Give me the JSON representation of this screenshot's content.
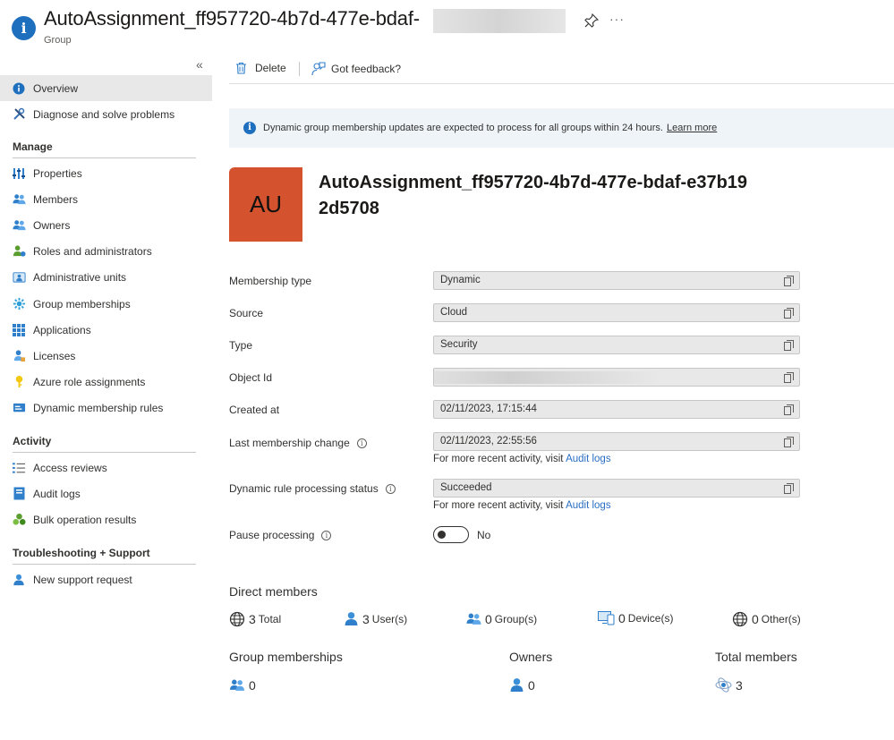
{
  "header": {
    "title": "AutoAssignment_ff957720-4b7d-477e-bdaf-",
    "subtitle": "Group"
  },
  "sidebar": {
    "top_items": [
      {
        "label": "Overview",
        "icon": "info-icon"
      },
      {
        "label": "Diagnose and solve problems",
        "icon": "wrench-icon"
      }
    ],
    "sections": [
      {
        "title": "Manage",
        "items": [
          {
            "label": "Properties",
            "icon": "properties-icon"
          },
          {
            "label": "Members",
            "icon": "members-icon"
          },
          {
            "label": "Owners",
            "icon": "owners-icon"
          },
          {
            "label": "Roles and administrators",
            "icon": "roles-icon"
          },
          {
            "label": "Administrative units",
            "icon": "admin-units-icon"
          },
          {
            "label": "Group memberships",
            "icon": "group-memberships-icon"
          },
          {
            "label": "Applications",
            "icon": "applications-icon"
          },
          {
            "label": "Licenses",
            "icon": "licenses-icon"
          },
          {
            "label": "Azure role assignments",
            "icon": "key-icon"
          },
          {
            "label": "Dynamic membership rules",
            "icon": "dynamic-rules-icon"
          }
        ]
      },
      {
        "title": "Activity",
        "items": [
          {
            "label": "Access reviews",
            "icon": "access-reviews-icon"
          },
          {
            "label": "Audit logs",
            "icon": "audit-logs-icon"
          },
          {
            "label": "Bulk operation results",
            "icon": "bulk-icon"
          }
        ]
      },
      {
        "title": "Troubleshooting + Support",
        "items": [
          {
            "label": "New support request",
            "icon": "support-icon"
          }
        ]
      }
    ]
  },
  "toolbar": {
    "delete_label": "Delete",
    "feedback_label": "Got feedback?"
  },
  "banner": {
    "text": "Dynamic group membership updates are expected to process for all groups within 24 hours.",
    "link": "Learn more"
  },
  "group": {
    "initials": "AU",
    "name": "AutoAssignment_ff957720-4b7d-477e-bdaf-e37b192d5708"
  },
  "properties": {
    "membership_type": {
      "label": "Membership type",
      "value": "Dynamic"
    },
    "source": {
      "label": "Source",
      "value": "Cloud"
    },
    "type": {
      "label": "Type",
      "value": "Security"
    },
    "object_id": {
      "label": "Object Id",
      "value": ""
    },
    "created_at": {
      "label": "Created at",
      "value": "02/11/2023, 17:15:44"
    },
    "last_membership_change": {
      "label": "Last membership change",
      "value": "02/11/2023, 22:55:56"
    },
    "dynamic_rule_status": {
      "label": "Dynamic rule processing status",
      "value": "Succeeded"
    },
    "pause_processing": {
      "label": "Pause processing",
      "value": "No"
    },
    "note_text": "For more recent activity, visit",
    "note_link": "Audit logs"
  },
  "direct_members": {
    "title": "Direct members",
    "total": {
      "count": "3",
      "label": "Total"
    },
    "users": {
      "count": "3",
      "label": "User(s)"
    },
    "groups": {
      "count": "0",
      "label": "Group(s)"
    },
    "devices": {
      "count": "0",
      "label": "Device(s)"
    },
    "others": {
      "count": "0",
      "label": "Other(s)"
    }
  },
  "stats": {
    "group_memberships": {
      "label": "Group memberships",
      "value": "0"
    },
    "owners": {
      "label": "Owners",
      "value": "0"
    },
    "total_members": {
      "label": "Total members",
      "value": "3"
    }
  },
  "colors": {
    "accent": "#1f6fbf",
    "tile": "#d5522f",
    "link": "#2b6ec3"
  }
}
